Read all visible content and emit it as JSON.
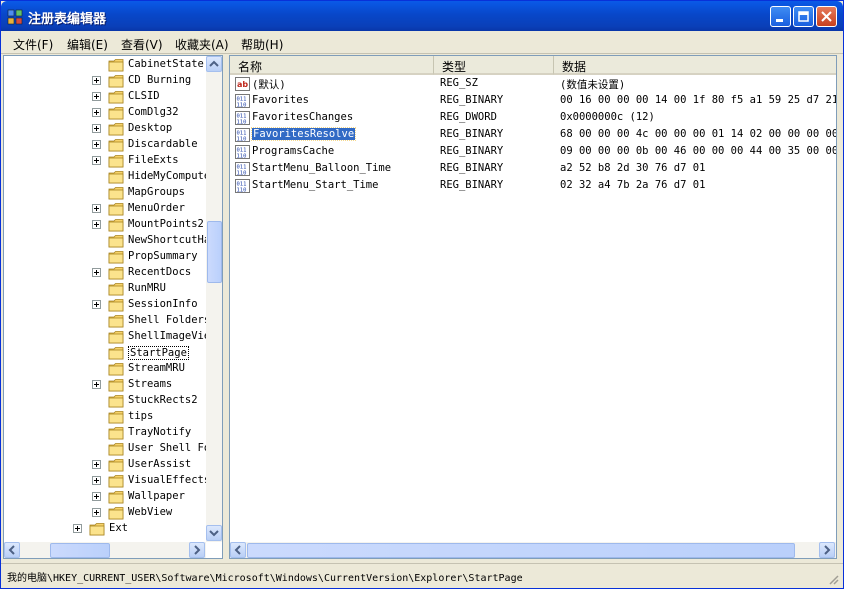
{
  "window": {
    "title": "注册表编辑器"
  },
  "menu": [
    "文件(F)",
    "编辑(E)",
    "查看(V)",
    "收藏夹(A)",
    "帮助(H)"
  ],
  "tree": {
    "items": [
      {
        "label": "CabinetState",
        "expander": false
      },
      {
        "label": "CD Burning",
        "expander": true
      },
      {
        "label": "CLSID",
        "expander": true
      },
      {
        "label": "ComDlg32",
        "expander": true
      },
      {
        "label": "Desktop",
        "expander": true
      },
      {
        "label": "Discardable",
        "expander": true
      },
      {
        "label": "FileExts",
        "expander": true
      },
      {
        "label": "HideMyCompute",
        "expander": false
      },
      {
        "label": "MapGroups",
        "expander": false
      },
      {
        "label": "MenuOrder",
        "expander": true
      },
      {
        "label": "MountPoints2",
        "expander": true
      },
      {
        "label": "NewShortcutHa",
        "expander": false
      },
      {
        "label": "PropSummary",
        "expander": false
      },
      {
        "label": "RecentDocs",
        "expander": true
      },
      {
        "label": "RunMRU",
        "expander": false
      },
      {
        "label": "SessionInfo",
        "expander": true
      },
      {
        "label": "Shell Folders",
        "expander": false
      },
      {
        "label": "ShellImageVie",
        "expander": false
      },
      {
        "label": "StartPage",
        "expander": false,
        "selected": true
      },
      {
        "label": "StreamMRU",
        "expander": false
      },
      {
        "label": "Streams",
        "expander": true
      },
      {
        "label": "StuckRects2",
        "expander": false
      },
      {
        "label": "tips",
        "expander": false
      },
      {
        "label": "TrayNotify",
        "expander": false
      },
      {
        "label": "User Shell Fo",
        "expander": false
      },
      {
        "label": "UserAssist",
        "expander": true
      },
      {
        "label": "VisualEffects",
        "expander": true
      },
      {
        "label": "Wallpaper",
        "expander": true
      },
      {
        "label": "WebView",
        "expander": true
      },
      {
        "label": "Ext",
        "expander": true,
        "level": 0
      }
    ]
  },
  "list": {
    "headers": {
      "name": "名称",
      "type": "类型",
      "data": "数据"
    },
    "rows": [
      {
        "name": "(默认)",
        "type": "REG_SZ",
        "data": "(数值未设置)",
        "icon": "string-value-icon"
      },
      {
        "name": "Favorites",
        "type": "REG_BINARY",
        "data": "00 16 00 00 00 14 00 1f 80 f5 a1 59 25 d7 21 d",
        "icon": "binary-value-icon"
      },
      {
        "name": "FavoritesChanges",
        "type": "REG_DWORD",
        "data": "0x0000000c (12)",
        "icon": "binary-value-icon"
      },
      {
        "name": "FavoritesResolve",
        "type": "REG_BINARY",
        "data": "68 00 00 00 4c 00 00 00 01 14 02 00 00 00 00 0",
        "icon": "binary-value-icon",
        "selected": true
      },
      {
        "name": "ProgramsCache",
        "type": "REG_BINARY",
        "data": "09 00 00 00 0b 00 46 00 00 00 44 00 35 00 00 0",
        "icon": "binary-value-icon"
      },
      {
        "name": "StartMenu_Balloon_Time",
        "type": "REG_BINARY",
        "data": "a2 52 b8 2d 30 76 d7 01",
        "icon": "binary-value-icon"
      },
      {
        "name": "StartMenu_Start_Time",
        "type": "REG_BINARY",
        "data": "02 32 a4 7b 2a 76 d7 01",
        "icon": "binary-value-icon"
      }
    ]
  },
  "status": {
    "path": "我的电脑\\HKEY_CURRENT_USER\\Software\\Microsoft\\Windows\\CurrentVersion\\Explorer\\StartPage"
  },
  "colors": {
    "titlebar": "#0a5ae8",
    "selection": "#316ac5"
  }
}
